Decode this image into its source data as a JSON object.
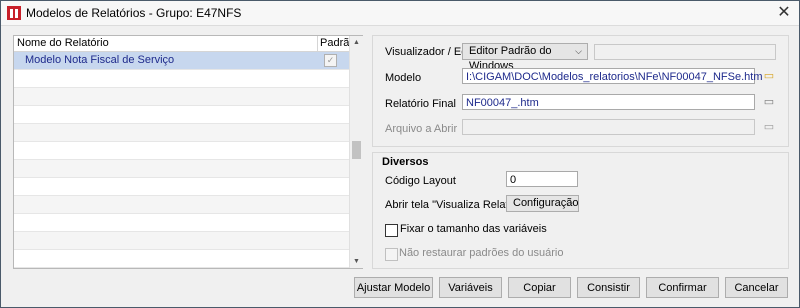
{
  "window": {
    "title": "Modelos de Relatórios - Grupo: E47NFS",
    "close_symbol": "✕"
  },
  "list": {
    "columns": {
      "name": "Nome do Relatório",
      "default": "Padrão"
    },
    "rows": [
      {
        "name": "Modelo Nota Fiscal de Serviço",
        "default_checked": true
      }
    ],
    "check_glyph": "✓",
    "scroll_up": "▲",
    "scroll_down": "▼"
  },
  "settings": {
    "viewer_label": "Visualizador / Editor",
    "viewer_value": "Editor Padrão do Windows",
    "viewer_extra": "",
    "modelo_label": "Modelo",
    "modelo_value": "I:\\CIGAM\\DOC\\Modelos_relatorios\\NFe\\NF00047_NFSe.htm",
    "final_label": "Relatório Final",
    "final_value": "NF00047_.htm",
    "open_label": "Arquivo a Abrir",
    "open_value": ""
  },
  "diversos": {
    "title": "Diversos",
    "layout_label": "Código Layout",
    "layout_value": "0",
    "open_screen_label": "Abrir tela \"Visualiza Relatório\"",
    "open_screen_value": "Configuração",
    "fix_size_label": "Fixar o tamanho das variáveis",
    "fix_size_checked": false,
    "no_restore_label": "Não restaurar padrões do usuário",
    "no_restore_checked": false
  },
  "buttons": {
    "adjust": "Ajustar Modelo",
    "variables": "Variáveis",
    "copy": "Copiar",
    "check": "Consistir",
    "confirm": "Confirmar",
    "cancel": "Cancelar"
  },
  "combo_arrow": "⌵"
}
